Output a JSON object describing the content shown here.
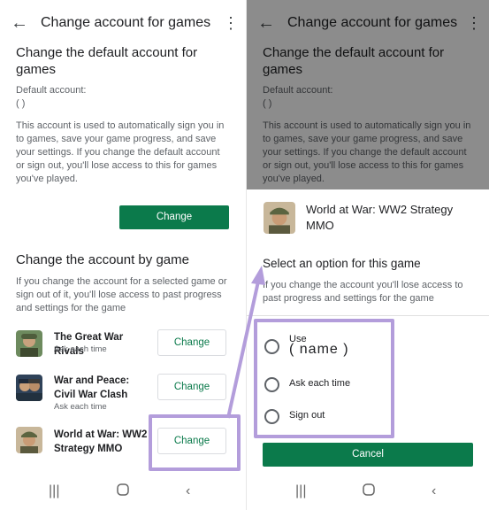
{
  "colors": {
    "accent": "#0b7a4b",
    "highlight": "#b39ddb",
    "overlay": "rgba(0,0,0,0.45)"
  },
  "app": {
    "title": "Change account for games",
    "back_icon": "arrow-left-icon",
    "menu_icon": "more-vert-icon"
  },
  "default_section": {
    "heading": "Change the default account for games",
    "default_label": "Default account:",
    "account_parens": "(                    )",
    "description": "This account is used to automatically sign you in to games, save your game progress, and save your settings. If you change the default account or sign out, you'll lose access to this for games you've played.",
    "change_label": "Change"
  },
  "by_game_section": {
    "heading": "Change the account by game",
    "description": "If you change the account for a selected game or sign out of it, you'll lose access to past progress and settings for the game",
    "games": [
      {
        "name": "The Great War Rivals",
        "sub": "Ask each time",
        "button": "Change"
      },
      {
        "name": "War and Peace: Civil War Clash",
        "sub": "Ask each time",
        "button": "Change"
      },
      {
        "name": "World at War: WW2 Strategy MMO",
        "sub": "",
        "button": "Change"
      }
    ]
  },
  "sheet": {
    "game_title": "World at War: WW2 Strategy MMO",
    "heading": "Select an option for this game",
    "description": "If you change the account you'll lose access to past progress and settings for the game",
    "options": [
      {
        "label": "Use",
        "sub": "( name )"
      },
      {
        "label": "Ask each time",
        "sub": ""
      },
      {
        "label": "Sign out",
        "sub": ""
      }
    ],
    "cancel_label": "Cancel"
  },
  "nav": {
    "recent_icon": "recent-apps-icon",
    "home_icon": "home-icon",
    "back_icon": "nav-back-icon"
  }
}
